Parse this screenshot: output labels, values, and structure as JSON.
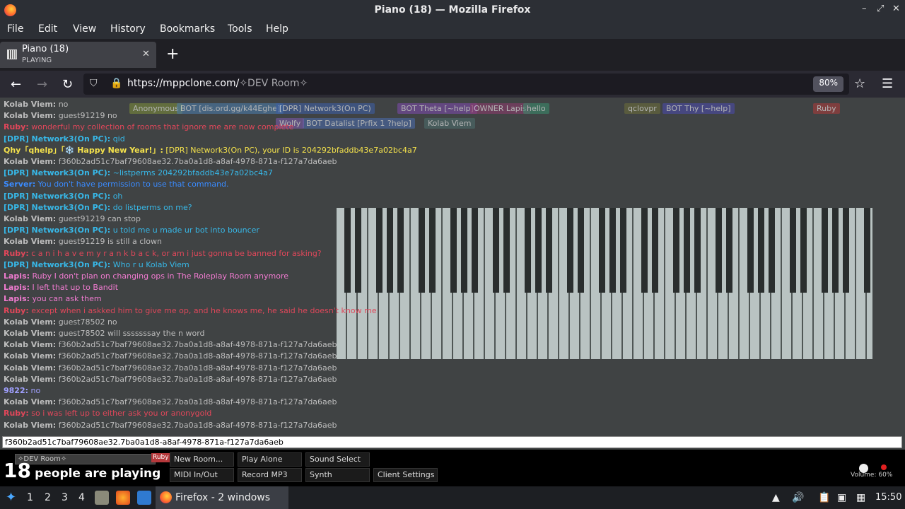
{
  "window": {
    "title": "Piano (18) — Mozilla Firefox"
  },
  "menu": [
    "File",
    "Edit",
    "View",
    "History",
    "Bookmarks",
    "Tools",
    "Help"
  ],
  "tab": {
    "title": "Piano (18)",
    "status": "PLAYING"
  },
  "url": {
    "host": "https://mppclone.com/",
    "path": "✧DEV Room✧",
    "zoom": "80%"
  },
  "users": [
    {
      "label": "Anonymous",
      "color": "#7a8a3b"
    },
    {
      "label": "BOT [dis.ord.gg/k44Eghe]",
      "color": "#4a7aa8"
    },
    {
      "label": "[DPR] Network3(On PC)",
      "color": "#3d5fa3"
    },
    {
      "label": "BOT Theta [~help]",
      "color": "#7b4aa8"
    },
    {
      "label": "OWNER Lapis",
      "color": "#8a3b6b"
    },
    {
      "label": "hello",
      "color": "#3b8a6b"
    },
    {
      "label": "qclovpr",
      "color": "#6b6b3b"
    },
    {
      "label": "BOT Thy [~help]",
      "color": "#4a4aa8"
    },
    {
      "label": "Ruby",
      "color": "#a83b3b"
    },
    {
      "label": "BOT Datalist [Prfix 1 ?help]",
      "color": "#4a6aa8"
    },
    {
      "label": "Kolab Viem",
      "color": "#4d6b6b"
    },
    {
      "label": "Wolfy",
      "color": "#7a5aa8"
    }
  ],
  "chat": [
    {
      "name": "Kolab Viem:",
      "text": "no",
      "color": "#bdbdbd"
    },
    {
      "name": "Kolab Viem:",
      "text": "guest91219 no",
      "color": "#bdbdbd"
    },
    {
      "name": "Ruby:",
      "text": "wonderful my collection of rooms that ignore me are now complete",
      "color": "#e0475a"
    },
    {
      "name": "[DPR] Network3(On PC):",
      "text": "qid",
      "color": "#37b8e8"
    },
    {
      "name": "Qhy「qhelp」「❄️ Happy New Year!」:",
      "text": "[DPR] Network3(On PC), your ID is 204292bfaddb43e7a02bc4a7",
      "color": "#f4e24c"
    },
    {
      "name": "Kolab Viem:",
      "text": "f360b2ad51c7baf79608ae32.7ba0a1d8-a8af-4978-871a-f127a7da6aeb",
      "color": "#bdbdbd"
    },
    {
      "name": "[DPR] Network3(On PC):",
      "text": "~listperms 204292bfaddb43e7a02bc4a7",
      "color": "#37b8e8"
    },
    {
      "name": "Server:",
      "text": "You don't have permission to use that command.",
      "color": "#3a8bff"
    },
    {
      "name": "[DPR] Network3(On PC):",
      "text": "oh",
      "color": "#37b8e8"
    },
    {
      "name": "[DPR] Network3(On PC):",
      "text": "do listperms on me?",
      "color": "#37b8e8"
    },
    {
      "name": "Kolab Viem:",
      "text": "guest91219 can stop",
      "color": "#bdbdbd"
    },
    {
      "name": "[DPR] Network3(On PC):",
      "text": "u told me u made ur bot into bouncer",
      "color": "#37b8e8"
    },
    {
      "name": "Kolab Viem:",
      "text": "guest91219 is still a clown",
      "color": "#bdbdbd"
    },
    {
      "name": "Ruby:",
      "text": "c a n i h a v e m y r a n k b a c k, or am i just gonna be banned for asking?",
      "color": "#e0475a"
    },
    {
      "name": "[DPR] Network3(On PC):",
      "text": "Who r u Kolab Viem",
      "color": "#37b8e8"
    },
    {
      "name": "Lapis:",
      "text": "Ruby I don't plan on changing ops in The Roleplay Room anymore",
      "color": "#f07bd0"
    },
    {
      "name": "Lapis:",
      "text": "I left that up to Bandit",
      "color": "#f07bd0"
    },
    {
      "name": "Lapis:",
      "text": "you can ask them",
      "color": "#f07bd0"
    },
    {
      "name": "Ruby:",
      "text": "except when i askked him to give me op, and he knows me, he said he doesn't know me",
      "color": "#e0475a"
    },
    {
      "name": "Kolab Viem:",
      "text": "guest78502 no",
      "color": "#bdbdbd"
    },
    {
      "name": "Kolab Viem:",
      "text": "guest78502 will sssssssay the n word",
      "color": "#bdbdbd"
    },
    {
      "name": "Kolab Viem:",
      "text": "f360b2ad51c7baf79608ae32.7ba0a1d8-a8af-4978-871a-f127a7da6aeb",
      "color": "#bdbdbd"
    },
    {
      "name": "Kolab Viem:",
      "text": "f360b2ad51c7baf79608ae32.7ba0a1d8-a8af-4978-871a-f127a7da6aeb",
      "color": "#bdbdbd"
    },
    {
      "name": "Kolab Viem:",
      "text": "f360b2ad51c7baf79608ae32.7ba0a1d8-a8af-4978-871a-f127a7da6aeb",
      "color": "#bdbdbd"
    },
    {
      "name": "Kolab Viem:",
      "text": "f360b2ad51c7baf79608ae32.7ba0a1d8-a8af-4978-871a-f127a7da6aeb",
      "color": "#bdbdbd"
    },
    {
      "name": "9822:",
      "text": "no",
      "color": "#a0a0ff"
    },
    {
      "name": "Kolab Viem:",
      "text": "f360b2ad51c7baf79608ae32.7ba0a1d8-a8af-4978-871a-f127a7da6aeb",
      "color": "#bdbdbd"
    },
    {
      "name": "Ruby:",
      "text": "so i was left up to either ask you or anonygold",
      "color": "#e0475a"
    },
    {
      "name": "Kolab Viem:",
      "text": "f360b2ad51c7baf79608ae32.7ba0a1d8-a8af-4978-871a-f127a7da6aeb",
      "color": "#bdbdbd"
    }
  ],
  "chat_input": "f360b2ad51c7baf79608ae32.7ba0a1d8-a8af-4978-871a-f127a7da6aeb",
  "room": {
    "name": "✧DEV Room✧",
    "tag": "Ruby"
  },
  "players": {
    "count": "18",
    "label": "people are playing"
  },
  "buttons": [
    "New Room...",
    "Play Alone",
    "Sound Select",
    "MIDI In/Out",
    "Record MP3",
    "Synth",
    "Client Settings"
  ],
  "volume": "Volume: 60%",
  "taskbar": {
    "workspaces": [
      "1",
      "2",
      "3",
      "4"
    ],
    "window": "Firefox - 2 windows",
    "clock": "15:50"
  }
}
